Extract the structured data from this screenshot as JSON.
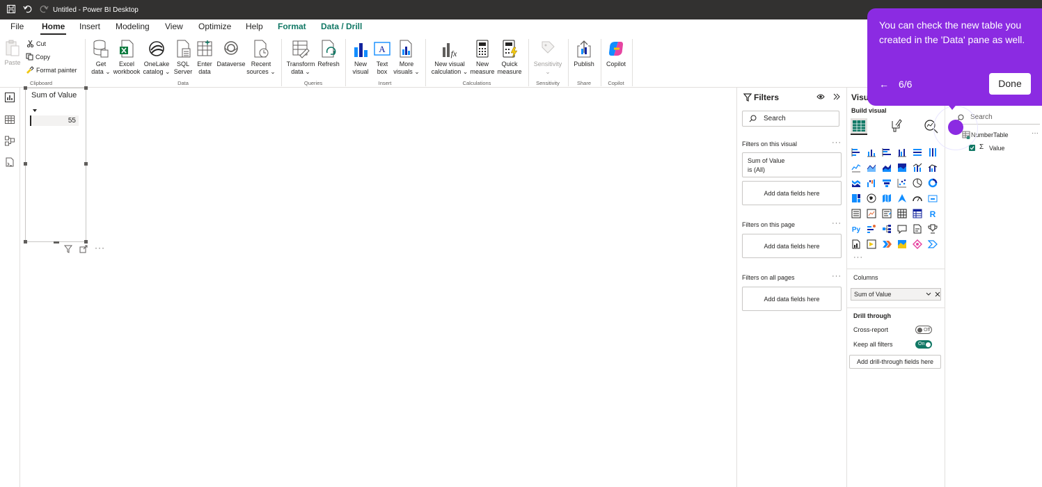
{
  "titlebar": {
    "title": "Untitled - Power BI Desktop"
  },
  "menu": {
    "tabs": [
      {
        "label": "File"
      },
      {
        "label": "Home"
      },
      {
        "label": "Insert"
      },
      {
        "label": "Modeling"
      },
      {
        "label": "View"
      },
      {
        "label": "Optimize"
      },
      {
        "label": "Help"
      },
      {
        "label": "Format"
      },
      {
        "label": "Data / Drill"
      }
    ]
  },
  "ribbon": {
    "clipboard": {
      "paste": "Paste",
      "cut": "Cut",
      "copy": "Copy",
      "format_painter": "Format painter",
      "group": "Clipboard"
    },
    "data": {
      "group": "Data",
      "buttons": [
        {
          "l1": "Get",
          "l2": "data ⌄"
        },
        {
          "l1": "Excel",
          "l2": "workbook"
        },
        {
          "l1": "OneLake",
          "l2": "catalog ⌄"
        },
        {
          "l1": "SQL",
          "l2": "Server"
        },
        {
          "l1": "Enter",
          "l2": "data"
        },
        {
          "l1": "Dataverse",
          "l2": ""
        },
        {
          "l1": "Recent",
          "l2": "sources ⌄"
        }
      ]
    },
    "queries": {
      "group": "Queries",
      "buttons": [
        {
          "l1": "Transform",
          "l2": "data ⌄"
        },
        {
          "l1": "Refresh",
          "l2": ""
        }
      ]
    },
    "insert": {
      "group": "Insert",
      "buttons": [
        {
          "l1": "New",
          "l2": "visual"
        },
        {
          "l1": "Text",
          "l2": "box"
        },
        {
          "l1": "More",
          "l2": "visuals ⌄"
        }
      ]
    },
    "calculations": {
      "group": "Calculations",
      "buttons": [
        {
          "l1": "New visual",
          "l2": "calculation ⌄"
        },
        {
          "l1": "New",
          "l2": "measure"
        },
        {
          "l1": "Quick",
          "l2": "measure"
        }
      ]
    },
    "sensitivity": {
      "group": "Sensitivity",
      "button": "Sensitivity",
      "caret": "⌄"
    },
    "share": {
      "group": "Share",
      "button": "Publish"
    },
    "copilot": {
      "group": "Copilot",
      "button": "Copilot"
    }
  },
  "visual": {
    "title": "Sum of Value",
    "value": "55"
  },
  "filters": {
    "title": "Filters",
    "search_placeholder": "Search",
    "on_visual": "Filters on this visual",
    "card_line1": "Sum of Value",
    "card_line2": "is (All)",
    "add_fields": "Add data fields here",
    "on_page": "Filters on this page",
    "on_all_pages": "Filters on all pages",
    "dots": "···"
  },
  "visualizations": {
    "title": "Visu",
    "build_visual": "Build visual",
    "more": "···",
    "columns_label": "Columns",
    "column_field": "Sum of Value",
    "drill_through": "Drill through",
    "cross_report": "Cross-report",
    "cross_report_state": "Off",
    "keep_all_filters": "Keep all filters",
    "keep_all_filters_state": "On",
    "add_drill_fields": "Add drill-through fields here"
  },
  "data_pane": {
    "search_placeholder": "Search",
    "table_name": "NumberTable",
    "field_name": "Value",
    "dots": "···"
  },
  "tooltip": {
    "text": "You can check the new table you created in the 'Data' pane as well.",
    "back": "←",
    "counter": "6/6",
    "done": "Done"
  },
  "colors": {
    "accent": "#8b2be2",
    "brand_green": "#117865",
    "titlebar": "#323130"
  }
}
